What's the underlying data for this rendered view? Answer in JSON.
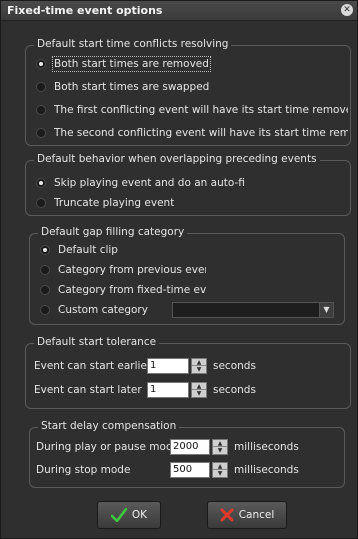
{
  "window": {
    "title": "Fixed-time event options"
  },
  "groups": {
    "conflicts": {
      "legend": "Default start time conflicts resolving",
      "options": [
        {
          "label": "Both start times are removed",
          "checked": true
        },
        {
          "label": "Both start times are swapped",
          "checked": false
        },
        {
          "label": "The first conflicting event will have its start time removed",
          "checked": false
        },
        {
          "label": "The second conflicting event will have its start time remov",
          "checked": false
        }
      ]
    },
    "overlap": {
      "legend": "Default behavior when overlapping preceding events",
      "options": [
        {
          "label": "Skip playing event and do an auto-fi",
          "checked": true
        },
        {
          "label": "Truncate playing event",
          "checked": false
        }
      ]
    },
    "gap": {
      "legend": "Default gap filling category",
      "options": [
        {
          "label": "Default clip",
          "checked": true
        },
        {
          "label": "Category from previous even",
          "checked": false
        },
        {
          "label": "Category from fixed-time eve",
          "checked": false
        },
        {
          "label": "Custom category",
          "checked": false
        }
      ],
      "custom_category_value": ""
    },
    "tolerance": {
      "legend": "Default start tolerance",
      "earlier_label": "Event can start earlier",
      "earlier_value": "1",
      "later_label": "Event can start later",
      "later_value": "1",
      "unit": "seconds"
    },
    "delay": {
      "legend": "Start delay compensation",
      "play_label": "During play or pause mode",
      "play_value": "2000",
      "stop_label": "During stop mode",
      "stop_value": "500",
      "unit": "milliseconds"
    }
  },
  "buttons": {
    "ok": "OK",
    "cancel": "Cancel"
  },
  "colors": {
    "ok_check": "#3cc83c",
    "cancel_x": "#e03a2a"
  }
}
